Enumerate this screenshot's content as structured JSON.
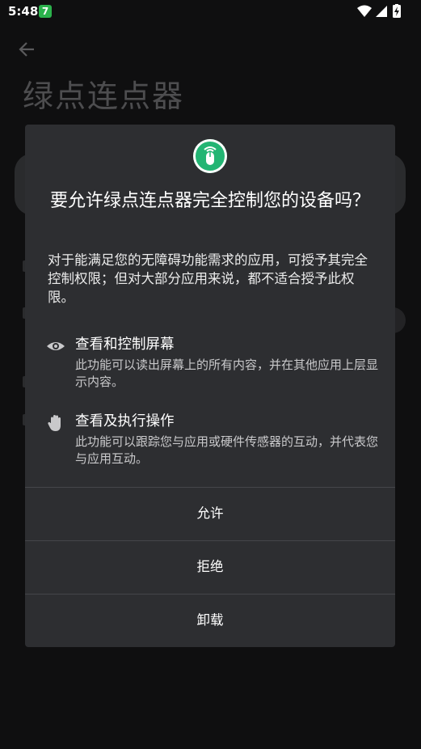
{
  "status_bar": {
    "time": "5:48",
    "badge_glyph": "7",
    "icons": [
      "wifi-icon",
      "signal-icon",
      "battery-charging-icon"
    ]
  },
  "background": {
    "title": "绿点连点器",
    "back_icon": "arrow-left-icon"
  },
  "dialog": {
    "app_icon": "mouse-icon",
    "accent_color": "#22b573",
    "title": "要允许绿点连点器完全控制您的设备吗？",
    "description": "对于能满足您的无障碍功能需求的应用，可授予其完全控制权限；但对大部分应用来说，都不适合授予此权限。",
    "permissions": [
      {
        "icon": "eye-icon",
        "title": "查看和控制屏幕",
        "description": "此功能可以读出屏幕上的所有内容，并在其他应用上层显示内容。"
      },
      {
        "icon": "hand-icon",
        "title": "查看及执行操作",
        "description": "此功能可以跟踪您与应用或硬件传感器的互动，并代表您与应用互动。"
      }
    ],
    "buttons": {
      "allow": "允许",
      "deny": "拒绝",
      "uninstall": "卸载"
    }
  }
}
